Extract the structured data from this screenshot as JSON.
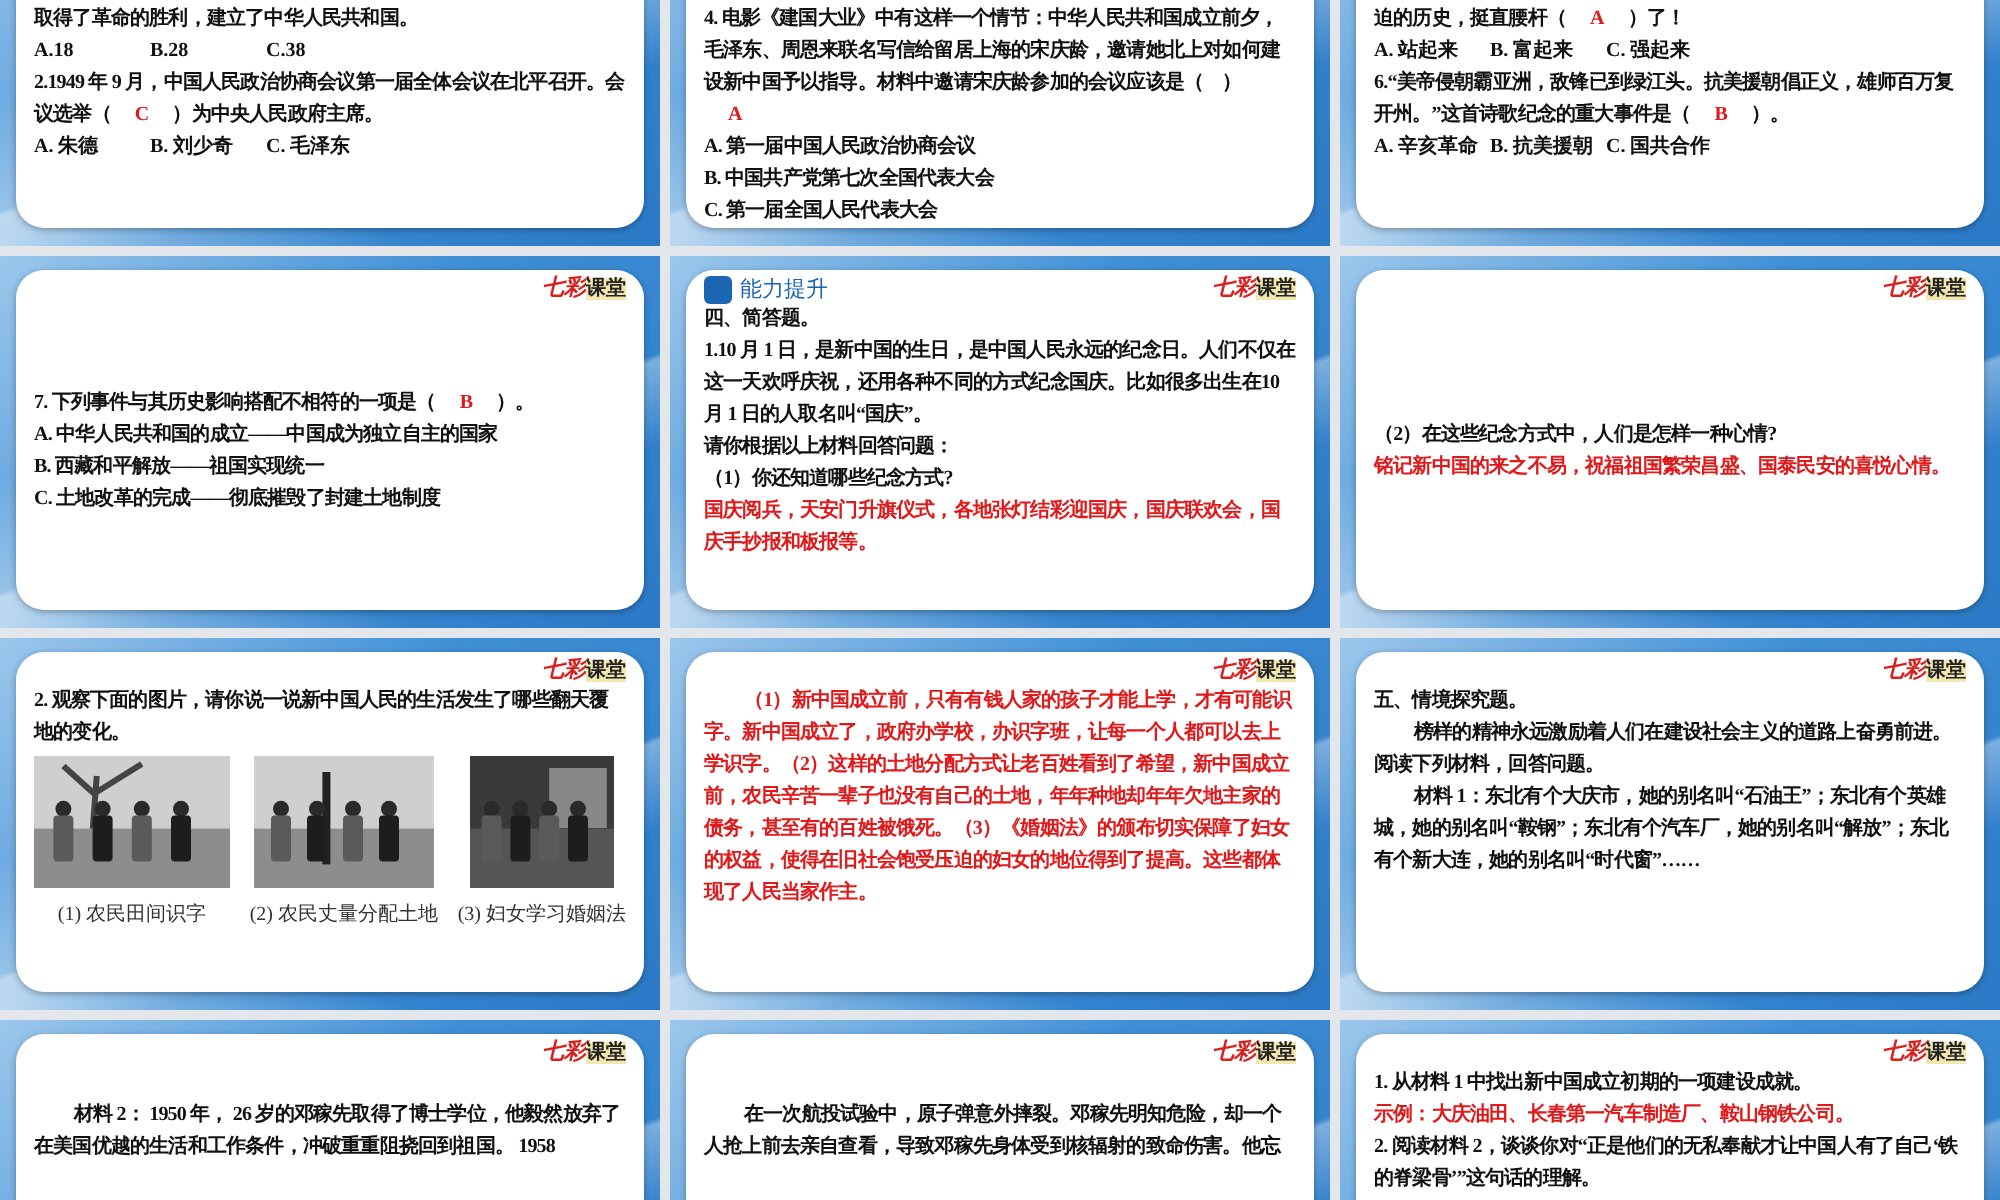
{
  "slides": [
    {
      "lines": [
        {
          "kind": "question",
          "text": "取得了革命的胜利，建立了中华人民共和国。"
        },
        {
          "kind": "options",
          "options": [
            "A.18",
            "B.28",
            "C.38"
          ]
        },
        {
          "kind": "question",
          "text": "2.1949 年 9 月，中国人民政治协商会议第一届全体会议在北平召开。会议选举（",
          "answer": "C",
          "after": "）为中央人民政府主席。"
        },
        {
          "kind": "options",
          "options": [
            "A. 朱德",
            "B. 刘少奇",
            "C. 毛泽东"
          ]
        }
      ]
    },
    {
      "lines": [
        {
          "kind": "question",
          "text": "4. 电影《建国大业》中有这样一个情节：中华人民共和国成立前夕，毛泽东、周恩来联名写信给留居上海的宋庆龄，邀请她北上对如何建设新中国予以指导。材料中邀请宋庆龄参加的会议应该是（　）",
          "answer": "A"
        },
        {
          "kind": "question",
          "text": "A. 第一届中国人民政治协商会议"
        },
        {
          "kind": "question",
          "text": "B. 中国共产党第七次全国代表大会"
        },
        {
          "kind": "question",
          "text": "C. 第一届全国人民代表大会"
        }
      ]
    },
    {
      "lines": [
        {
          "kind": "question",
          "text": "迫的历史，挺直腰杆（",
          "answer": "A",
          "after": "）了！"
        },
        {
          "kind": "options",
          "options": [
            "A. 站起来",
            "B. 富起来",
            "C. 强起来"
          ]
        },
        {
          "kind": "question",
          "text": "6.“美帝侵朝霸亚洲，敌锋已到绿江头。抗美援朝倡正义，雄师百万复开州。”这首诗歌纪念的重大事件是（",
          "answer": "B",
          "after": "）。"
        },
        {
          "kind": "options",
          "options": [
            "A. 辛亥革命",
            "B. 抗美援朝",
            "C. 国共合作"
          ]
        }
      ]
    },
    {
      "logo": {
        "mark": "七彩",
        "word": "课堂"
      },
      "lines": [
        {
          "kind": "question",
          "text": "7. 下列事件与其历史影响搭配不相符的一项是（",
          "answer": "B",
          "after": "）。"
        },
        {
          "kind": "question",
          "text": "A. 中华人民共和国的成立——中国成为独立自主的国家"
        },
        {
          "kind": "question",
          "text": "B. 西藏和平解放——祖国实现统一"
        },
        {
          "kind": "question",
          "text": "C. 土地改革的完成——彻底摧毁了封建土地制度"
        }
      ]
    },
    {
      "logo": {
        "mark": "七彩",
        "word": "课堂"
      },
      "heading": "能力提升",
      "lines": [
        {
          "kind": "question",
          "text": "四、简答题。"
        },
        {
          "kind": "question",
          "text": "1.10 月 1 日，是新中国的生日，是中国人民永远的纪念日。人们不仅在这一天欢呼庆祝，还用各种不同的方式纪念国庆。比如很多出生在10 月 1 日的人取名叫“国庆”。"
        },
        {
          "kind": "question",
          "text": "请你根据以上材料回答问题："
        },
        {
          "kind": "question",
          "text": "（1）你还知道哪些纪念方式?"
        },
        {
          "kind": "answer",
          "text": "国庆阅兵，天安门升旗仪式，各地张灯结彩迎国庆，国庆联欢会，国庆手抄报和板报等。"
        }
      ]
    },
    {
      "logo": {
        "mark": "七彩",
        "word": "课堂"
      },
      "lines": [
        {
          "kind": "question",
          "text": "（2）在这些纪念方式中，人们是怎样一种心情?"
        },
        {
          "kind": "answer",
          "text": "铭记新中国的来之不易，祝福祖国繁荣昌盛、国泰民安的喜悦心情。"
        }
      ]
    },
    {
      "logo": {
        "mark": "七彩",
        "word": "课堂"
      },
      "lines": [
        {
          "kind": "question",
          "text": "2. 观察下面的图片，请你说一说新中国人民的生活发生了哪些翻天覆地的变化。"
        },
        {
          "kind": "photos",
          "photos": [
            {
              "kind": "picture",
              "caption": "(1) 农民田间识字"
            },
            {
              "kind": "picture",
              "caption": "(2) 农民丈量分配土地"
            },
            {
              "kind": "picture",
              "caption": "(3) 妇女学习婚姻法"
            }
          ]
        }
      ]
    },
    {
      "logo": {
        "mark": "七彩",
        "word": "课堂"
      },
      "lines": [
        {
          "kind": "answer",
          "indent": true,
          "text": "（1）新中国成立前，只有有钱人家的孩子才能上学，才有可能识字。新中国成立了，政府办学校，办识字班，让每一个人都可以去上学识字。（2）这样的土地分配方式让老百姓看到了希望，新中国成立前，农民辛苦一辈子也没有自己的土地，年年种地却年年欠地主家的债务，甚至有的百姓被饿死。（3）《婚姻法》的颁布切实保障了妇女的权益，使得在旧社会饱受压迫的妇女的地位得到了提高。这些都体现了人民当家作主。"
        }
      ]
    },
    {
      "logo": {
        "mark": "七彩",
        "word": "课堂"
      },
      "lines": [
        {
          "kind": "question",
          "text": "五、情境探究题。"
        },
        {
          "kind": "question",
          "indent": true,
          "text": "榜样的精神永远激励着人们在建设社会主义的道路上奋勇前进。阅读下列材料，回答问题。"
        },
        {
          "kind": "question",
          "indent": true,
          "text": "材料 1：东北有个大庆市，她的别名叫“石油王”；东北有个英雄城，她的别名叫“鞍钢”；东北有个汽车厂，她的别名叫“解放”；东北有个新大连，她的别名叫“时代窗”……"
        }
      ]
    },
    {
      "logo": {
        "mark": "七彩",
        "word": "课堂"
      },
      "lines": [
        {
          "kind": "question",
          "indent": true,
          "text": "材料 2： 1950 年， 26 岁的邓稼先取得了博士学位，他毅然放弃了在美国优越的生活和工作条件，冲破重重阻挠回到祖国。 1958"
        }
      ]
    },
    {
      "logo": {
        "mark": "七彩",
        "word": "课堂"
      },
      "lines": [
        {
          "kind": "question",
          "indent": true,
          "text": "在一次航投试验中，原子弹意外摔裂。邓稼先明知危险，却一个人抢上前去亲自查看，导致邓稼先身体受到核辐射的致命伤害。他忘"
        }
      ]
    },
    {
      "logo": {
        "mark": "七彩",
        "word": "课堂"
      },
      "lines": [
        {
          "kind": "question",
          "text": "1. 从材料 1 中找出新中国成立初期的一项建设成就。"
        },
        {
          "kind": "answer",
          "text": "示例：大庆油田、长春第一汽车制造厂、鞍山钢铁公司。"
        },
        {
          "kind": "question",
          "text": "2. 阅读材料 2，谈谈你对“正是他们的无私奉献才让中国人有了自己‘铁的脊梁骨’”这句话的理解。"
        }
      ]
    }
  ]
}
